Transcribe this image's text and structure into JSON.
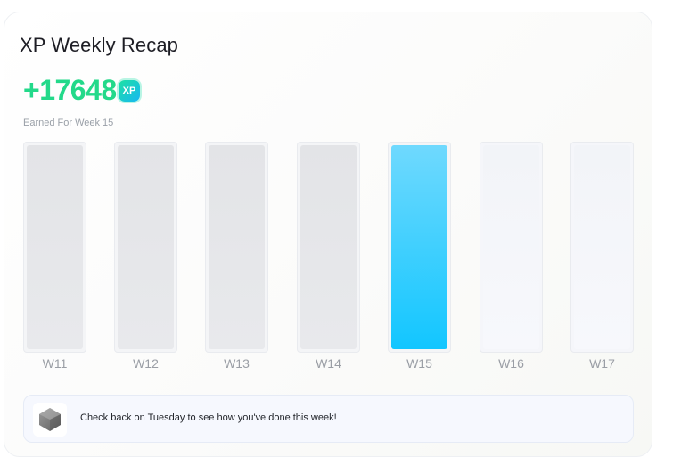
{
  "card": {
    "title": "XP Weekly Recap",
    "xp_value": "+17648",
    "xp_badge": "XP",
    "earned_label": "Earned For Week 15"
  },
  "weeks": [
    {
      "label": "W11",
      "state": "past"
    },
    {
      "label": "W12",
      "state": "past"
    },
    {
      "label": "W13",
      "state": "past"
    },
    {
      "label": "W14",
      "state": "past"
    },
    {
      "label": "W15",
      "state": "current"
    },
    {
      "label": "W16",
      "state": "future"
    },
    {
      "label": "W17",
      "state": "future"
    }
  ],
  "notice": {
    "text": "Check back on Tuesday to see how you've done this week!",
    "icon": "hexagon-icon"
  },
  "colors": {
    "xp_green": "#23d98a",
    "current_bar": "#12c6ff",
    "past_bar": "#e3e4e7",
    "future_bar": "#f4f5f9"
  }
}
